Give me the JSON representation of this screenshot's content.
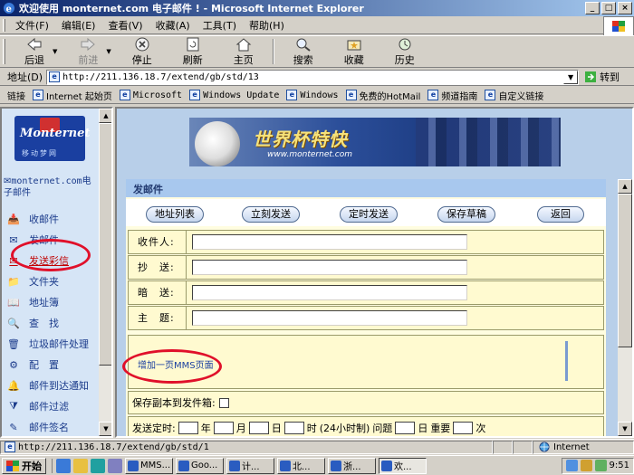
{
  "window": {
    "title": "欢迎使用 monternet.com 电子邮件 ! - Microsoft Internet Explorer"
  },
  "menu": [
    "文件(F)",
    "编辑(E)",
    "查看(V)",
    "收藏(A)",
    "工具(T)",
    "帮助(H)"
  ],
  "toolbar": {
    "back": "后退",
    "forward": "前进",
    "stop": "停止",
    "refresh": "刷新",
    "home": "主页",
    "search": "搜索",
    "favorites": "收藏",
    "history": "历史"
  },
  "address": {
    "label": "地址(D)",
    "url": "http://211.136.18.7/extend/gb/std/13",
    "go": "转到"
  },
  "links": {
    "label": "链接",
    "items": [
      "Internet 起始页",
      "Microsoft",
      "Windows Update",
      "Windows",
      "免费的HotMail",
      "频道指南",
      "自定义链接"
    ]
  },
  "sidebar": {
    "logo": "Monternet",
    "logo_sub": "移动梦网",
    "account": "monternet.com电子邮件",
    "items": [
      "收邮件",
      "发邮件",
      "发送彩信",
      "文件夹",
      "地址簿",
      "查　找",
      "垃圾邮件处理",
      "配　置",
      "邮件到达通知",
      "邮件过滤",
      "邮件签名"
    ]
  },
  "banner": {
    "title": "世界杯特快",
    "url": "www.monternet.com"
  },
  "compose": {
    "section": "发邮件",
    "buttons": [
      "地址列表",
      "立刻发送",
      "定时发送",
      "保存草稿",
      "返回"
    ],
    "fields": [
      "收件人:",
      "抄　送:",
      "暗　送:",
      "主　题:"
    ],
    "mms_link": "增加一页MMS页面",
    "save_copy": "保存副本到发件箱:",
    "timed_label": "发送定时:",
    "timed_units": [
      "年",
      "月",
      "日",
      "时",
      "(24小时制)",
      "问题",
      "日",
      "重要",
      "次"
    ]
  },
  "status": {
    "url": "http://211.136.18.7/extend/gb/std/1",
    "zone": "Internet"
  },
  "taskbar": {
    "start": "开始",
    "tasks": [
      "MMS...",
      "Goo...",
      "计...",
      "北...",
      "浙...",
      "欢..."
    ],
    "clock": "9:51"
  },
  "colors": {
    "annotation": "#e0102a",
    "title_bar": "#0a246a",
    "section_bar": "#a8c8ee"
  }
}
